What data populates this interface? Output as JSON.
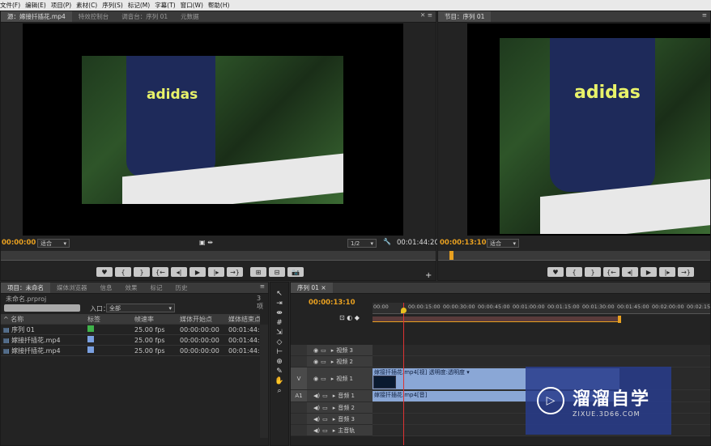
{
  "menu": {
    "items": [
      "文件(F)",
      "编辑(E)",
      "项目(P)",
      "素材(C)",
      "序列(S)",
      "标记(M)",
      "字幕(T)",
      "窗口(W)",
      "帮助(H)"
    ]
  },
  "source": {
    "tabs": [
      "源：嫁接扦插花.mp4",
      "特效控制台",
      "调音台：序列 01",
      "元数据"
    ],
    "tc_left": "00:00:00",
    "fit": "适合",
    "ratio": "1/2",
    "tc_right": "00:01:44:20"
  },
  "program": {
    "tab": "节目：序列 01",
    "tc_left": "00:00:13:10",
    "fit": "适合"
  },
  "overlay_text": "adidas",
  "project": {
    "tabs": [
      "项目：未命名",
      "媒体浏览器",
      "信息",
      "效果",
      "标记",
      "历史"
    ],
    "file": "未命名.prproj",
    "count": "3 项",
    "inpoint_label": "入口：",
    "inpoint_value": "全部",
    "columns": [
      "名称",
      "标签",
      "帧速率",
      "媒体开始点",
      "媒体结束点"
    ],
    "rows": [
      {
        "name": "序列 01",
        "color": "#3fb24a",
        "fps": "25.00 fps",
        "start": "00:00:00:00",
        "end": "00:01:44:19"
      },
      {
        "name": "嫁接扦插花.mp4",
        "color": "#7aa0e0",
        "fps": "25.00 fps",
        "start": "00:00:00:00",
        "end": "00:01:44:19"
      },
      {
        "name": "嫁接扦插花.mp4",
        "color": "#7aa0e0",
        "fps": "25.00 fps",
        "start": "00:00:00:00",
        "end": "00:01:44:19"
      }
    ]
  },
  "timeline": {
    "tab": "序列 01",
    "tc": "00:00:13:10",
    "ruler": [
      "00:00",
      "00:00:15:00",
      "00:00:30:00",
      "00:00:45:00",
      "00:01:00:00",
      "00:01:15:00",
      "00:01:30:00",
      "00:01:45:00",
      "00:02:00:00",
      "00:02:15:00"
    ],
    "v_label": "V",
    "a_label": "A1",
    "video_tracks": [
      "视频 3",
      "视频 2",
      "视频 1"
    ],
    "audio_tracks": [
      "音频 1",
      "音频 2",
      "音频 3"
    ],
    "master": "主音轨",
    "video_clip": "嫁接扦插花.mp4[视] 透明度:透明度 ▾",
    "audio_clip": "嫁接扦插花.mp4[音]"
  },
  "watermark": {
    "title": "溜溜自学",
    "url": "ZIXUE.3D66.COM"
  }
}
